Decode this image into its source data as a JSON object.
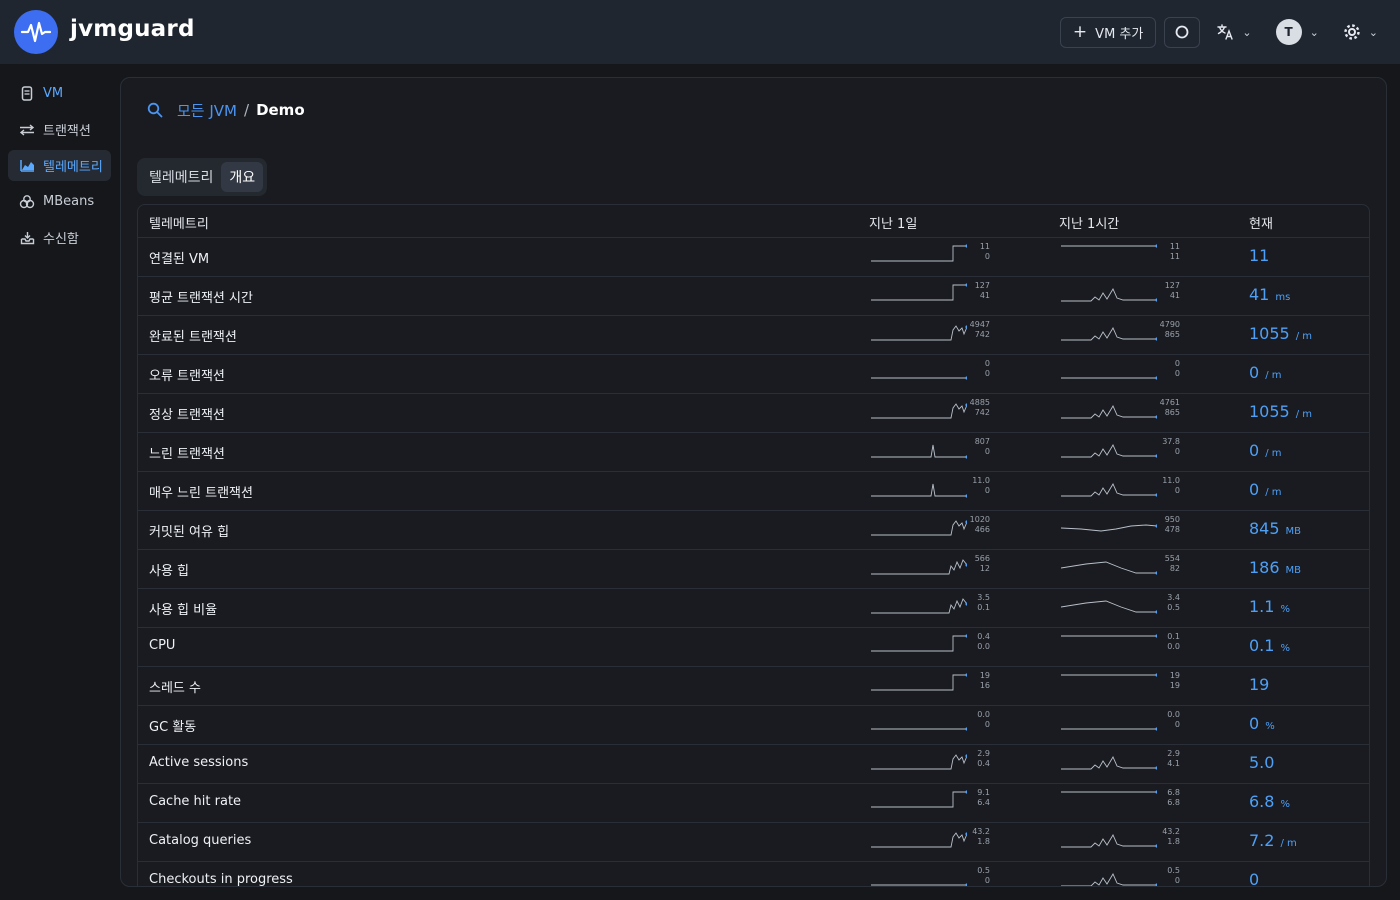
{
  "app": {
    "name": "jvmguard"
  },
  "topbar": {
    "add_vm_label": "VM 추가",
    "avatar_initial": "T"
  },
  "sidebar": {
    "items": [
      {
        "label": "VM",
        "icon": "server-icon",
        "active": false
      },
      {
        "label": "트랜잭션",
        "icon": "transactions-icon",
        "active": false
      },
      {
        "label": "텔레메트리",
        "icon": "chart-icon",
        "active": true
      },
      {
        "label": "MBeans",
        "icon": "beans-icon",
        "active": false
      },
      {
        "label": "수신함",
        "icon": "inbox-icon",
        "active": false
      }
    ]
  },
  "breadcrumb": {
    "root": "모든 JVM",
    "separator": "/",
    "current": "Demo"
  },
  "tabs": [
    {
      "label": "텔레메트리",
      "active": false
    },
    {
      "label": "개요",
      "active": true
    }
  ],
  "table": {
    "headers": {
      "name": "텔레메트리",
      "day": "지난 1일",
      "hour": "지난 1시간",
      "current": "현재"
    },
    "rows": [
      {
        "name": "연결된 VM",
        "day_max": "11",
        "day_min": "0",
        "hour_max": "11",
        "hour_min": "11",
        "value": "11",
        "unit": ""
      },
      {
        "name": "평균 트랜잭션 시간",
        "day_max": "127",
        "day_min": "41",
        "hour_max": "127",
        "hour_min": "41",
        "value": "41",
        "unit": "ms"
      },
      {
        "name": "완료된 트랜잭션",
        "day_max": "4947",
        "day_min": "742",
        "hour_max": "4790",
        "hour_min": "865",
        "value": "1055",
        "unit": "/ m"
      },
      {
        "name": "오류 트랜잭션",
        "day_max": "0",
        "day_min": "0",
        "hour_max": "0",
        "hour_min": "0",
        "value": "0",
        "unit": "/ m"
      },
      {
        "name": "정상 트랜잭션",
        "day_max": "4885",
        "day_min": "742",
        "hour_max": "4761",
        "hour_min": "865",
        "value": "1055",
        "unit": "/ m"
      },
      {
        "name": "느린 트랜잭션",
        "day_max": "807",
        "day_min": "0",
        "hour_max": "37.8",
        "hour_min": "0",
        "value": "0",
        "unit": "/ m"
      },
      {
        "name": "매우 느린 트랜잭션",
        "day_max": "11.0",
        "day_min": "0",
        "hour_max": "11.0",
        "hour_min": "0",
        "value": "0",
        "unit": "/ m"
      },
      {
        "name": "커밋된 여유 힙",
        "day_max": "1020",
        "day_min": "466",
        "hour_max": "950",
        "hour_min": "478",
        "value": "845",
        "unit": "MB"
      },
      {
        "name": "사용 힙",
        "day_max": "566",
        "day_min": "12",
        "hour_max": "554",
        "hour_min": "82",
        "value": "186",
        "unit": "MB"
      },
      {
        "name": "사용 힙 비율",
        "day_max": "3.5",
        "day_min": "0.1",
        "hour_max": "3.4",
        "hour_min": "0.5",
        "value": "1.1",
        "unit": "%"
      },
      {
        "name": "CPU",
        "day_max": "0.4",
        "day_min": "0.0",
        "hour_max": "0.1",
        "hour_min": "0.0",
        "value": "0.1",
        "unit": "%"
      },
      {
        "name": "스레드 수",
        "day_max": "19",
        "day_min": "16",
        "hour_max": "19",
        "hour_min": "19",
        "value": "19",
        "unit": ""
      },
      {
        "name": "GC 활동",
        "day_max": "0.0",
        "day_min": "0",
        "hour_max": "0.0",
        "hour_min": "0",
        "value": "0",
        "unit": "%"
      },
      {
        "name": "Active sessions",
        "day_max": "2.9",
        "day_min": "0.4",
        "hour_max": "2.9",
        "hour_min": "4.1",
        "value": "5.0",
        "unit": ""
      },
      {
        "name": "Cache hit rate",
        "day_max": "9.1",
        "day_min": "6.4",
        "hour_max": "6.8",
        "hour_min": "6.8",
        "value": "6.8",
        "unit": "%"
      },
      {
        "name": "Catalog queries",
        "day_max": "43.2",
        "day_min": "1.8",
        "hour_max": "43.2",
        "hour_min": "1.8",
        "value": "7.2",
        "unit": "/ m"
      },
      {
        "name": "Checkouts in progress",
        "day_max": "0.5",
        "day_min": "0",
        "hour_max": "0.5",
        "hour_min": "0",
        "value": "0",
        "unit": ""
      }
    ]
  },
  "colors": {
    "accent": "#4ea0f7",
    "logo": "#3d6ef2",
    "topbar": "#1f2630",
    "background": "#15171b"
  }
}
